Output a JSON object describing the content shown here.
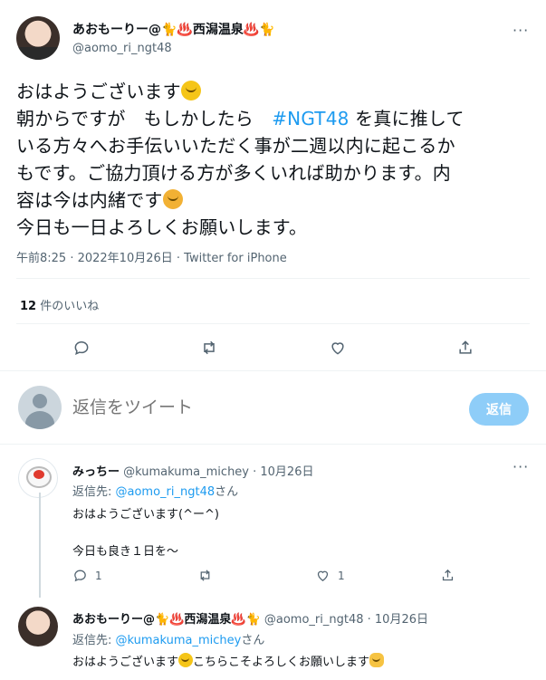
{
  "main_tweet": {
    "author_name": "あおもーりー@🐈♨️西潟温泉♨️🐈",
    "author_handle": "@aomo_ri_ngt48",
    "line1": "おはようございます",
    "line2a": "朝からですが　もしかしたら　",
    "hashtag": "#NGT48",
    "line2b": " を真に推して",
    "line3": "いる方々へお手伝いいただく事が二週以内に起こるか",
    "line4": "もです。ご協力頂ける方が多くいれば助かります。内",
    "line5": "容は今は内緒です",
    "line6": "今日も一日よろしくお願いします。",
    "meta": "午前8:25 · 2022年10月26日 · Twitter for iPhone",
    "likes_count": "12",
    "likes_label": " 件のいいね"
  },
  "actions": {
    "icons": [
      "reply-icon",
      "retweet-icon",
      "like-icon",
      "share-icon"
    ]
  },
  "reply_box": {
    "placeholder": "返信をツイート",
    "button_label": "返信"
  },
  "replies": [
    {
      "name": "みっちー",
      "handle_date": " @kumakuma_michey · 10月26日",
      "reply_to_prefix": "返信先: ",
      "reply_to_link": "@aomo_ri_ngt48",
      "reply_to_suffix": "さん",
      "text1": "おはようございます(^ー^)",
      "text2": "今日も良き１日を〜",
      "reply_count": "1",
      "like_count": "1"
    },
    {
      "name": "あおもーりー@🐈♨️西潟温泉♨️🐈",
      "handle_date": " @aomo_ri_ngt48 · 10月26日",
      "reply_to_prefix": "返信先: ",
      "reply_to_link": "@kumakuma_michey",
      "reply_to_suffix": "さん",
      "text1a": "おはようございます",
      "text1b": "こちらこそよろしくお願いします"
    }
  ],
  "more_label": "···"
}
